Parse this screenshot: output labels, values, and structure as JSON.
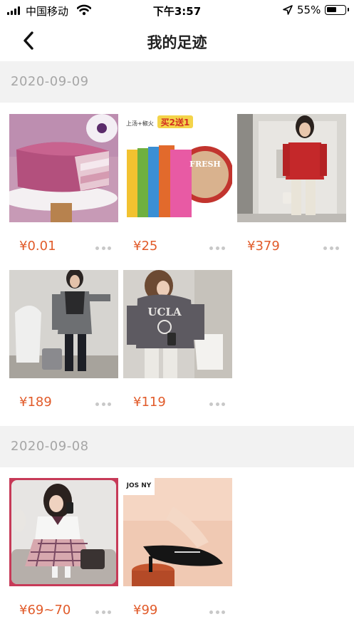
{
  "status_bar": {
    "carrier": "中国移动",
    "time": "下午3:57",
    "battery": "55%",
    "battery_level": 0.55
  },
  "nav": {
    "title": "我的足迹"
  },
  "groups": [
    {
      "date": "2020-09-09",
      "items": [
        {
          "price": "¥0.01",
          "image": "purple-taro-cake-photo"
        },
        {
          "price": "¥25",
          "image": "snack-pack-bundle-photo",
          "image_text": [
            "买2送1",
            "FRESH",
            "上汤+椒火"
          ]
        },
        {
          "price": "¥379",
          "image": "red-blazer-model-photo"
        },
        {
          "price": "¥189",
          "image": "grey-shirt-black-vest-model-photo"
        },
        {
          "price": "¥119",
          "image": "grey-ucla-hoodie-model-photo",
          "image_text": [
            "UCLA"
          ]
        }
      ]
    },
    {
      "date": "2020-09-08",
      "items": [
        {
          "price": "¥69~70",
          "image": "school-uniform-plaid-skirt-photo"
        },
        {
          "price": "¥99",
          "image": "black-kitten-heel-shoe-photo",
          "image_text": [
            "JOS NY"
          ]
        }
      ]
    }
  ],
  "icons": {
    "back": "chevron-left-icon",
    "more": "more-dots-icon",
    "wifi": "wifi-icon",
    "location": "location-arrow-icon",
    "signal": "cell-signal-icon",
    "battery": "battery-icon"
  },
  "colors": {
    "price": "#e15b2a",
    "date_header_bg": "#f2f2f2",
    "date_text": "#a6a6a6"
  }
}
